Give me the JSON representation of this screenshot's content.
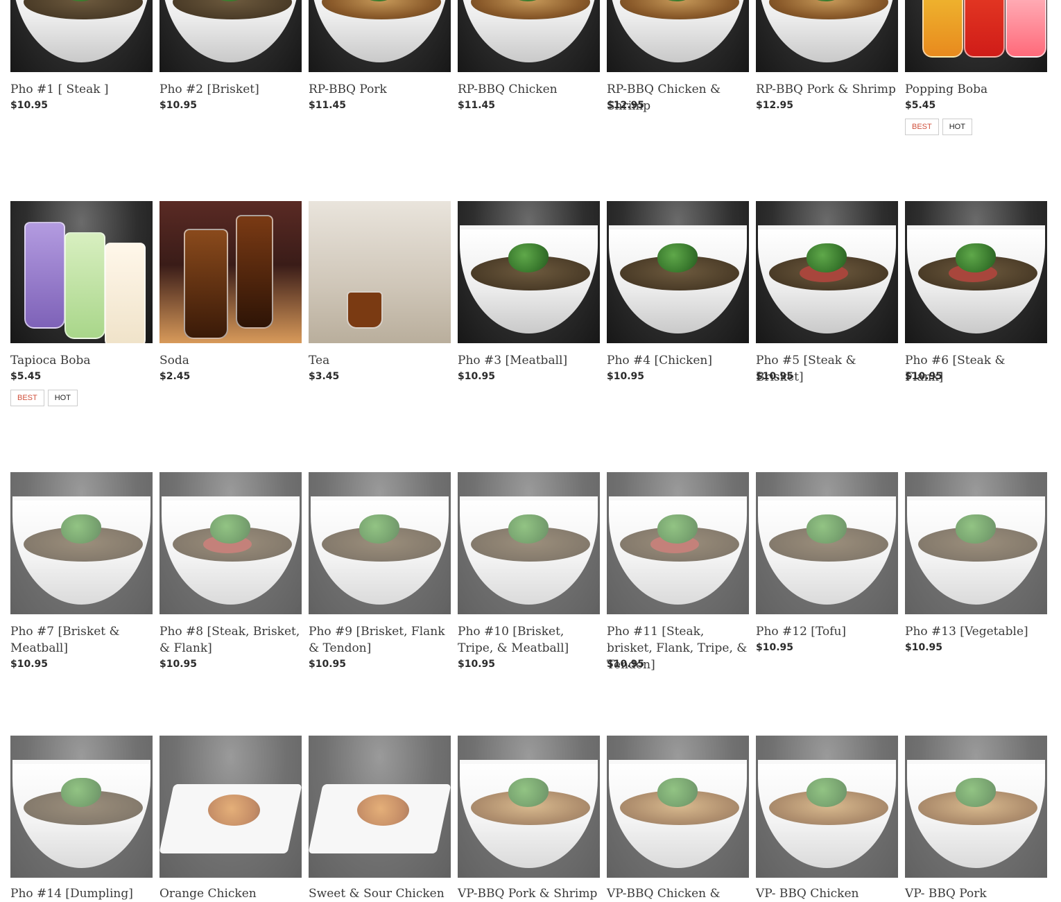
{
  "badges": {
    "best": "BEST",
    "hot": "HOT"
  },
  "menu": [
    {
      "name": "Pho #1 [ Steak ]",
      "price": "$10.95",
      "img": "pho-bowl"
    },
    {
      "name": "Pho #2 [Brisket]",
      "price": "$10.95",
      "img": "pho-bowl"
    },
    {
      "name": "RP-BBQ Pork",
      "price": "$11.45",
      "img": "noodle-salad-bowl"
    },
    {
      "name": "RP-BBQ Chicken",
      "price": "$11.45",
      "img": "noodle-salad-bowl"
    },
    {
      "name": "RP-BBQ Chicken & Shrimp",
      "price": "$12.95",
      "img": "noodle-salad-bowl"
    },
    {
      "name": "RP-BBQ Pork & Shrimp",
      "price": "$12.95",
      "img": "noodle-salad-bowl"
    },
    {
      "name": "Popping Boba",
      "price": "$5.45",
      "img": "drink-cups",
      "badges": [
        "BEST",
        "HOT"
      ]
    },
    {
      "name": "Tapioca Boba",
      "price": "$5.45",
      "img": "boba-cups",
      "badges": [
        "BEST",
        "HOT"
      ]
    },
    {
      "name": "Soda",
      "price": "$2.45",
      "img": "soda-glass"
    },
    {
      "name": "Tea",
      "price": "$3.45",
      "img": "tea-cup"
    },
    {
      "name": "Pho #3 [Meatball]",
      "price": "$10.95",
      "img": "pho-bowl"
    },
    {
      "name": "Pho #4 [Chicken]",
      "price": "$10.95",
      "img": "pho-bowl"
    },
    {
      "name": "Pho #5 [Steak & Brisket]",
      "price": "$10.95",
      "img": "pho-bowl-steak"
    },
    {
      "name": "Pho #6 [Steak & Flank]",
      "price": "$10.95",
      "img": "pho-bowl-steak"
    },
    {
      "name": "Pho #7 [Brisket & Meatball]",
      "price": "$10.95",
      "img": "pho-bowl"
    },
    {
      "name": "Pho #8 [Steak, Brisket, & Flank]",
      "price": "$10.95",
      "img": "pho-bowl-steak"
    },
    {
      "name": "Pho #9 [Brisket, Flank & Tendon]",
      "price": "$10.95",
      "img": "pho-bowl"
    },
    {
      "name": "Pho #10 [Brisket, Tripe, & Meatball]",
      "price": "$10.95",
      "img": "pho-bowl"
    },
    {
      "name": "Pho #11 [Steak, brisket, Flank, Tripe, & Tendon]",
      "price": "$10.95",
      "img": "pho-bowl-steak"
    },
    {
      "name": "Pho #12 [Tofu]",
      "price": "$10.95",
      "img": "pho-bowl"
    },
    {
      "name": "Pho #13 [Vegetable]",
      "price": "$10.95",
      "img": "pho-bowl"
    },
    {
      "name": "Pho #14 [Dumpling]",
      "img": "pho-bowl"
    },
    {
      "name": "Orange Chicken",
      "img": "plate"
    },
    {
      "name": "Sweet & Sour Chicken",
      "img": "plate"
    },
    {
      "name": "VP-BBQ Pork & Shrimp",
      "img": "noodle-salad-bowl"
    },
    {
      "name": "VP-BBQ Chicken &",
      "img": "noodle-salad-bowl"
    },
    {
      "name": "VP- BBQ Chicken",
      "img": "noodle-salad-bowl"
    },
    {
      "name": "VP- BBQ Pork",
      "img": "noodle-salad-bowl"
    }
  ]
}
